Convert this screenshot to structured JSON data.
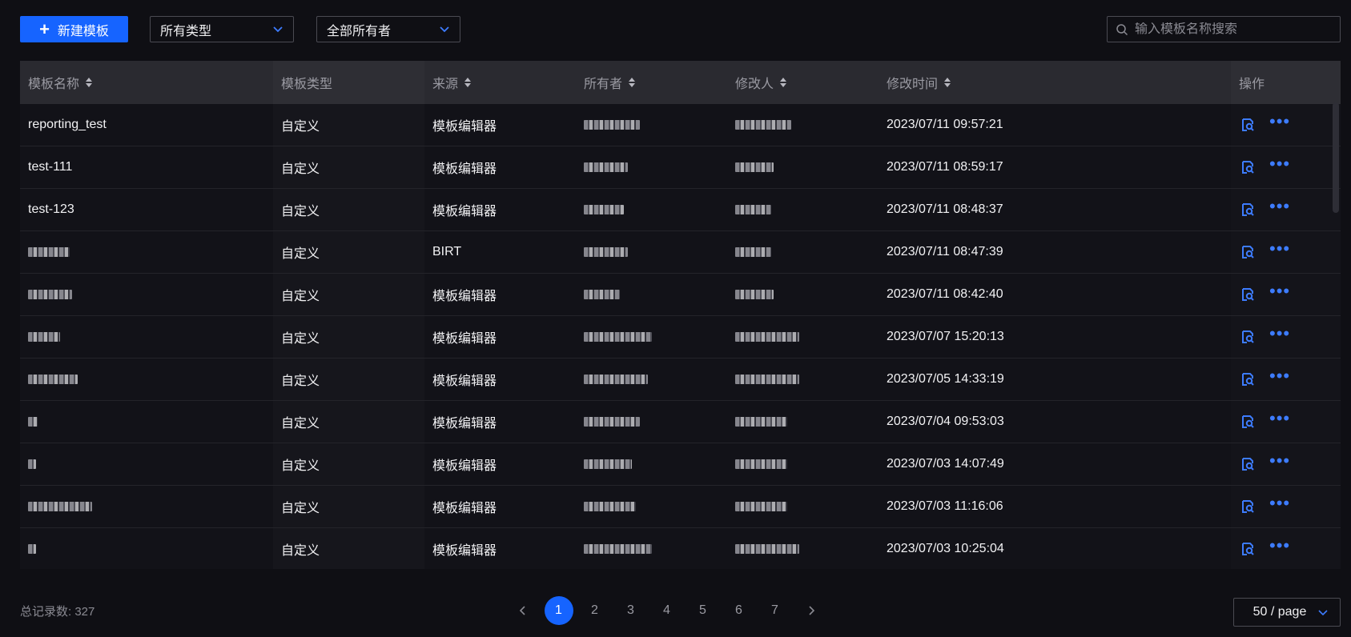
{
  "toolbar": {
    "new_button_label": "新建模板",
    "type_filter_value": "所有类型",
    "owner_filter_value": "全部所有者",
    "search_placeholder": "输入模板名称搜索"
  },
  "table": {
    "columns": [
      {
        "label": "模板名称",
        "sortable": true
      },
      {
        "label": "模板类型",
        "sortable": false
      },
      {
        "label": "来源",
        "sortable": true
      },
      {
        "label": "所有者",
        "sortable": true
      },
      {
        "label": "修改人",
        "sortable": true
      },
      {
        "label": "修改时间",
        "sortable": true
      },
      {
        "label": "操作",
        "sortable": false
      }
    ],
    "rows": [
      {
        "name": "reporting_test",
        "type": "自定义",
        "source": "模板编辑器",
        "modified_time": "2023/07/11 09:57:21"
      },
      {
        "name": "test-111",
        "type": "自定义",
        "source": "模板编辑器",
        "modified_time": "2023/07/11 08:59:17"
      },
      {
        "name": "test-123",
        "type": "自定义",
        "source": "模板编辑器",
        "modified_time": "2023/07/11 08:48:37"
      },
      {
        "name": "",
        "type": "自定义",
        "source": "BIRT",
        "modified_time": "2023/07/11 08:47:39"
      },
      {
        "name": "",
        "type": "自定义",
        "source": "模板编辑器",
        "modified_time": "2023/07/11 08:42:40"
      },
      {
        "name": "",
        "type": "自定义",
        "source": "模板编辑器",
        "modified_time": "2023/07/07 15:20:13"
      },
      {
        "name": "",
        "type": "自定义",
        "source": "模板编辑器",
        "modified_time": "2023/07/05 14:33:19"
      },
      {
        "name": "",
        "type": "自定义",
        "source": "模板编辑器",
        "modified_time": "2023/07/04 09:53:03"
      },
      {
        "name": "",
        "type": "自定义",
        "source": "模板编辑器",
        "modified_time": "2023/07/03 14:07:49"
      },
      {
        "name": "",
        "type": "自定义",
        "source": "模板编辑器",
        "modified_time": "2023/07/03 11:16:06"
      },
      {
        "name": "",
        "type": "自定义",
        "source": "模板编辑器",
        "modified_time": "2023/07/03 10:25:04"
      }
    ],
    "row_action_icons": [
      "view-icon",
      "more-icon"
    ]
  },
  "footer": {
    "total_label": "总记录数: 327",
    "pages": [
      "1",
      "2",
      "3",
      "4",
      "5",
      "6",
      "7"
    ],
    "current_page": "1",
    "page_size": "50 / page"
  },
  "colors": {
    "accent": "#1664ff",
    "background": "#0f0f14",
    "header_bg": "#2a2a30"
  }
}
